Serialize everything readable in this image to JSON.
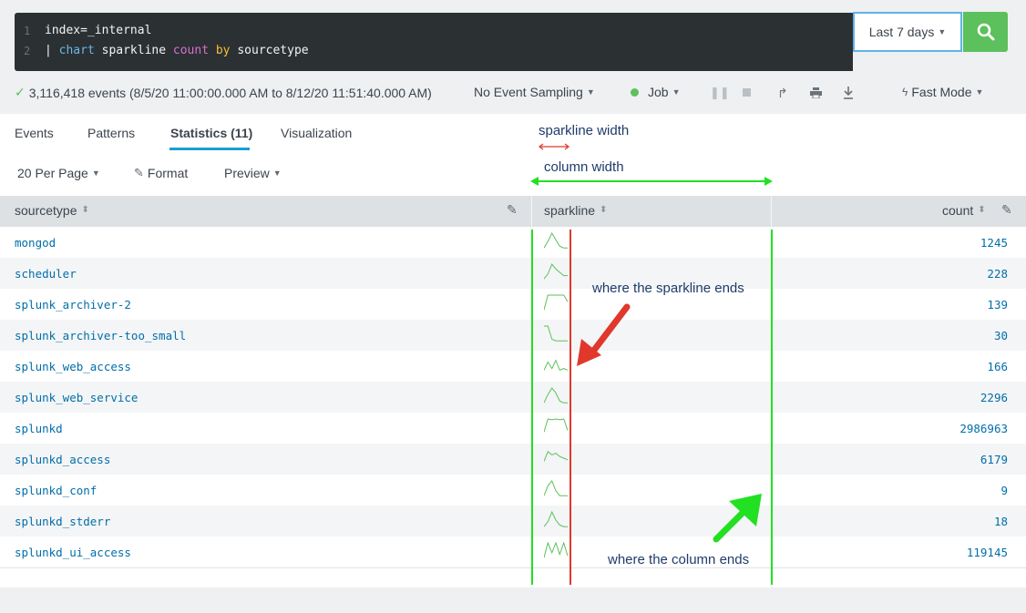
{
  "search": {
    "lines": [
      {
        "num": "1",
        "text": "index=_internal"
      },
      {
        "num": "2",
        "pipe": "| ",
        "cmd": "chart",
        "arg1": " sparkline ",
        "fn": "count",
        "sp": " ",
        "by": "by",
        "field": " sourcetype"
      }
    ],
    "time_range": "Last 7 days"
  },
  "status": {
    "events_text": "3,116,418 events (8/5/20 11:00:00.000 AM to 8/12/20 11:51:40.000 AM)",
    "sampling": "No Event Sampling",
    "job": "Job",
    "mode": "Fast Mode"
  },
  "tabs": [
    {
      "label": "Events"
    },
    {
      "label": "Patterns"
    },
    {
      "label": "Statistics (11)"
    },
    {
      "label": "Visualization"
    }
  ],
  "options": {
    "per_page": "20 Per Page",
    "format": "Format",
    "preview": "Preview"
  },
  "table": {
    "columns": [
      "sourcetype",
      "sparkline",
      "count"
    ],
    "rows": [
      {
        "sourcetype": "mongod",
        "count": "1245",
        "spark": [
          0.1,
          0.5,
          1,
          0.6,
          0.2,
          0.1,
          0.1
        ]
      },
      {
        "sourcetype": "scheduler",
        "count": "228",
        "spark": [
          0.1,
          0.4,
          1,
          0.7,
          0.5,
          0.3,
          0.3
        ]
      },
      {
        "sourcetype": "splunk_archiver-2",
        "count": "139",
        "spark": [
          0.1,
          1,
          1,
          1,
          1,
          1,
          0.6
        ]
      },
      {
        "sourcetype": "splunk_archiver-too_small",
        "count": "30",
        "spark": [
          1,
          1,
          0.2,
          0.1,
          0.1,
          0.1,
          0.1
        ]
      },
      {
        "sourcetype": "splunk_web_access",
        "count": "166",
        "spark": [
          0.2,
          0.7,
          0.3,
          0.8,
          0.2,
          0.3,
          0.2
        ]
      },
      {
        "sourcetype": "splunk_web_service",
        "count": "2296",
        "spark": [
          0.1,
          0.6,
          1,
          0.7,
          0.2,
          0.1,
          0.1
        ]
      },
      {
        "sourcetype": "splunkd",
        "count": "2986963",
        "spark": [
          0.2,
          1,
          0.95,
          1,
          0.95,
          1,
          0.3
        ]
      },
      {
        "sourcetype": "splunkd_access",
        "count": "6179",
        "spark": [
          0.3,
          0.9,
          0.7,
          0.8,
          0.6,
          0.5,
          0.4
        ]
      },
      {
        "sourcetype": "splunkd_conf",
        "count": "9",
        "spark": [
          0.1,
          0.7,
          1,
          0.4,
          0.1,
          0.1,
          0.1
        ]
      },
      {
        "sourcetype": "splunkd_stderr",
        "count": "18",
        "spark": [
          0.1,
          0.4,
          1,
          0.5,
          0.2,
          0.1,
          0.1
        ]
      },
      {
        "sourcetype": "splunkd_ui_access",
        "count": "119145",
        "spark": [
          0.1,
          1,
          0.4,
          1,
          0.3,
          1,
          0.2
        ]
      }
    ]
  },
  "annotations": {
    "sparkline_width": "sparkline width",
    "column_width": "column width",
    "sparkline_end": "where the sparkline ends",
    "column_end": "where the column ends"
  },
  "colors": {
    "accent": "#1a9cd8",
    "link": "#006ea9",
    "sparkline": "#5cc05c",
    "red_marker": "#e0382b",
    "green_marker": "#22e022",
    "search_button": "#5cc05c"
  },
  "icons": [
    "check-icon",
    "search-icon",
    "caret-down-icon",
    "pause-icon",
    "stop-icon",
    "share-icon",
    "print-icon",
    "export-icon",
    "lightning-icon",
    "pencil-icon",
    "sort-icon"
  ]
}
